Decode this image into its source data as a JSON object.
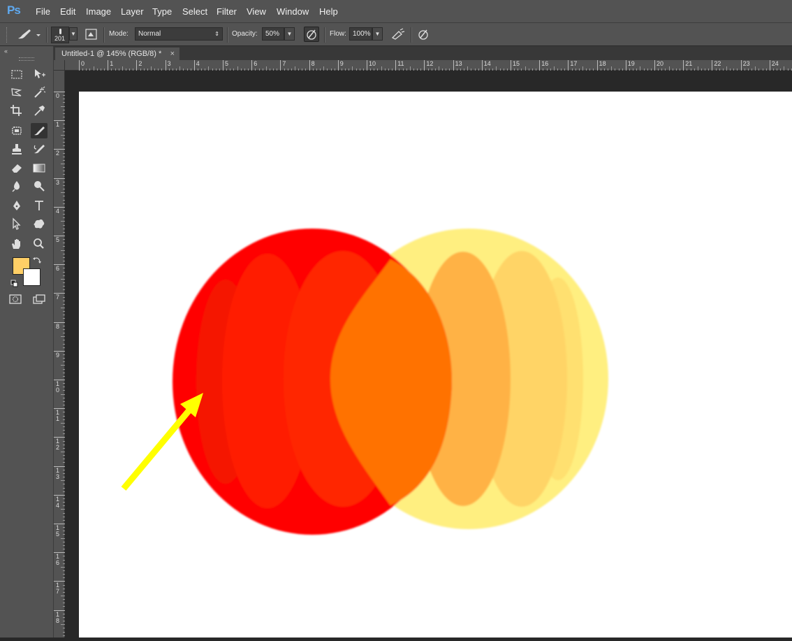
{
  "app": {
    "logo": "Ps",
    "menu": [
      "File",
      "Edit",
      "Image",
      "Layer",
      "Type",
      "Select",
      "Filter",
      "View",
      "Window",
      "Help"
    ]
  },
  "options": {
    "brush_size": "201",
    "mode_label": "Mode:",
    "mode_value": "Normal",
    "opacity_label": "Opacity:",
    "opacity_value": "50%",
    "flow_label": "Flow:",
    "flow_value": "100%"
  },
  "document": {
    "tab_title": "Untitled-1 @ 145% (RGB/8) *",
    "close_glyph": "×"
  },
  "rulers": {
    "horizontal": [
      "0",
      "1",
      "2",
      "3",
      "4",
      "5",
      "6",
      "7",
      "8",
      "9",
      "10",
      "11",
      "12",
      "13",
      "14",
      "15",
      "16",
      "17",
      "18",
      "19",
      "20",
      "21",
      "22",
      "23",
      "24"
    ],
    "vertical": [
      "0",
      "1",
      "2",
      "3",
      "4",
      "5",
      "6",
      "7",
      "8",
      "9",
      "10",
      "11",
      "12",
      "13",
      "14",
      "15",
      "16",
      "17",
      "18"
    ]
  },
  "colors": {
    "foreground": "#ffcf66",
    "background": "#ffffff",
    "red_circle": "#ff0000",
    "yellow_circle": "#ffef80",
    "arrow": "#ffff00"
  },
  "tools": [
    "marquee-icon",
    "move-icon",
    "lasso-icon",
    "magic-wand-icon",
    "crop-icon",
    "eyedropper-icon",
    "spot-heal-icon",
    "brush-icon",
    "clone-stamp-icon",
    "history-brush-icon",
    "eraser-icon",
    "gradient-icon",
    "blur-icon",
    "dodge-icon",
    "pen-icon",
    "type-icon",
    "path-select-icon",
    "shape-icon",
    "hand-icon",
    "zoom-icon"
  ]
}
